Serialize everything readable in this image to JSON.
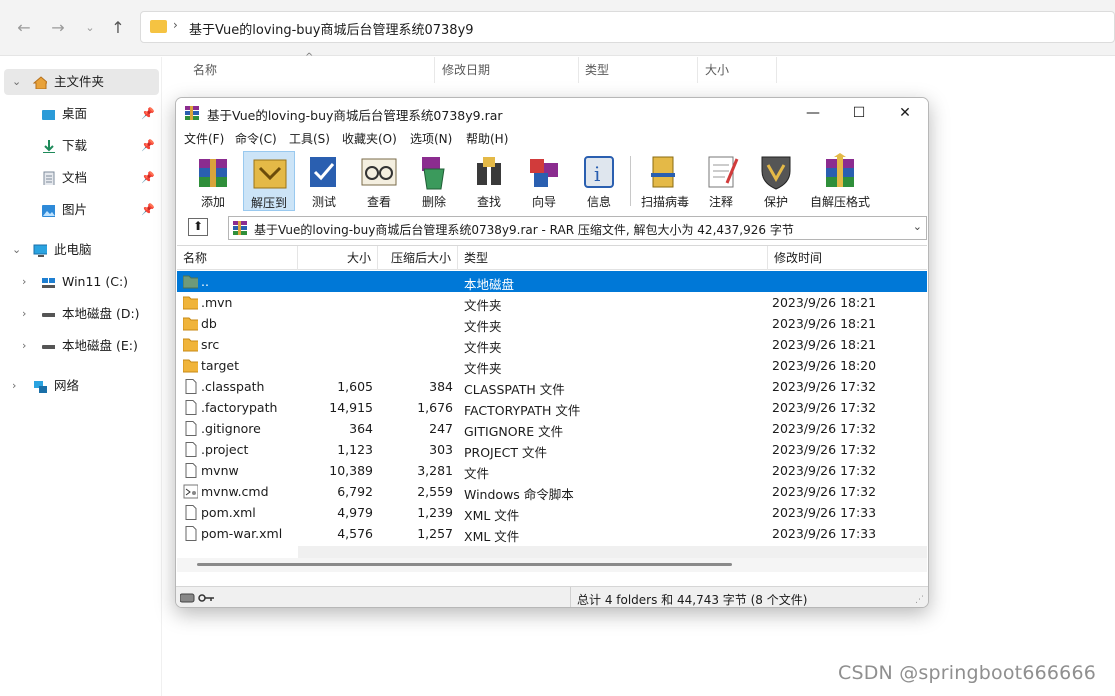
{
  "explorer": {
    "address_path": "基于Vue的loving-buy商城后台管理系统0738y9",
    "columns": [
      "名称",
      "修改日期",
      "类型",
      "大小"
    ],
    "sidebar": [
      {
        "label": "主文件夹",
        "icon": "home-icon"
      },
      {
        "label": "桌面",
        "icon": "desktop-icon"
      },
      {
        "label": "下载",
        "icon": "download-icon"
      },
      {
        "label": "文档",
        "icon": "document-icon"
      },
      {
        "label": "图片",
        "icon": "pictures-icon"
      },
      {
        "label": "此电脑",
        "icon": "computer-icon"
      },
      {
        "label": "Win11 (C:)",
        "icon": "drive-icon"
      },
      {
        "label": "本地磁盘 (D:)",
        "icon": "drive-icon"
      },
      {
        "label": "本地磁盘 (E:)",
        "icon": "drive-icon"
      },
      {
        "label": "网络",
        "icon": "network-icon"
      }
    ],
    "watermark": "CSDN @springboot666666"
  },
  "winrar": {
    "title": "基于Vue的loving-buy商城后台管理系统0738y9.rar",
    "menus": [
      "文件(F)",
      "命令(C)",
      "工具(S)",
      "收藏夹(O)",
      "选项(N)",
      "帮助(H)"
    ],
    "toolbar": [
      "添加",
      "解压到",
      "测试",
      "查看",
      "删除",
      "查找",
      "向导",
      "信息",
      "扫描病毒",
      "注释",
      "保护",
      "自解压格式"
    ],
    "path_text": "基于Vue的loving-buy商城后台管理系统0738y9.rar - RAR 压缩文件, 解包大小为 42,437,926 字节",
    "headers": [
      "名称",
      "大小",
      "压缩后大小",
      "类型",
      "修改时间"
    ],
    "files": [
      {
        "name": "..",
        "size": "",
        "packed": "",
        "type": "本地磁盘",
        "modified": "",
        "kind": "up"
      },
      {
        "name": ".mvn",
        "size": "",
        "packed": "",
        "type": "文件夹",
        "modified": "2023/9/26 18:21",
        "kind": "folder"
      },
      {
        "name": "db",
        "size": "",
        "packed": "",
        "type": "文件夹",
        "modified": "2023/9/26 18:21",
        "kind": "folder"
      },
      {
        "name": "src",
        "size": "",
        "packed": "",
        "type": "文件夹",
        "modified": "2023/9/26 18:21",
        "kind": "folder"
      },
      {
        "name": "target",
        "size": "",
        "packed": "",
        "type": "文件夹",
        "modified": "2023/9/26 18:20",
        "kind": "folder"
      },
      {
        "name": ".classpath",
        "size": "1,605",
        "packed": "384",
        "type": "CLASSPATH 文件",
        "modified": "2023/9/26 17:32",
        "kind": "file"
      },
      {
        "name": ".factorypath",
        "size": "14,915",
        "packed": "1,676",
        "type": "FACTORYPATH 文件",
        "modified": "2023/9/26 17:32",
        "kind": "file"
      },
      {
        "name": ".gitignore",
        "size": "364",
        "packed": "247",
        "type": "GITIGNORE 文件",
        "modified": "2023/9/26 17:32",
        "kind": "file"
      },
      {
        "name": ".project",
        "size": "1,123",
        "packed": "303",
        "type": "PROJECT 文件",
        "modified": "2023/9/26 17:32",
        "kind": "file"
      },
      {
        "name": "mvnw",
        "size": "10,389",
        "packed": "3,281",
        "type": "文件",
        "modified": "2023/9/26 17:32",
        "kind": "file"
      },
      {
        "name": "mvnw.cmd",
        "size": "6,792",
        "packed": "2,559",
        "type": "Windows 命令脚本",
        "modified": "2023/9/26 17:32",
        "kind": "cmd"
      },
      {
        "name": "pom.xml",
        "size": "4,979",
        "packed": "1,239",
        "type": "XML 文件",
        "modified": "2023/9/26 17:33",
        "kind": "file"
      },
      {
        "name": "pom-war.xml",
        "size": "4,576",
        "packed": "1,257",
        "type": "XML 文件",
        "modified": "2023/9/26 17:33",
        "kind": "file"
      }
    ],
    "status": "总计 4 folders 和 44,743 字节 (8 个文件)"
  }
}
